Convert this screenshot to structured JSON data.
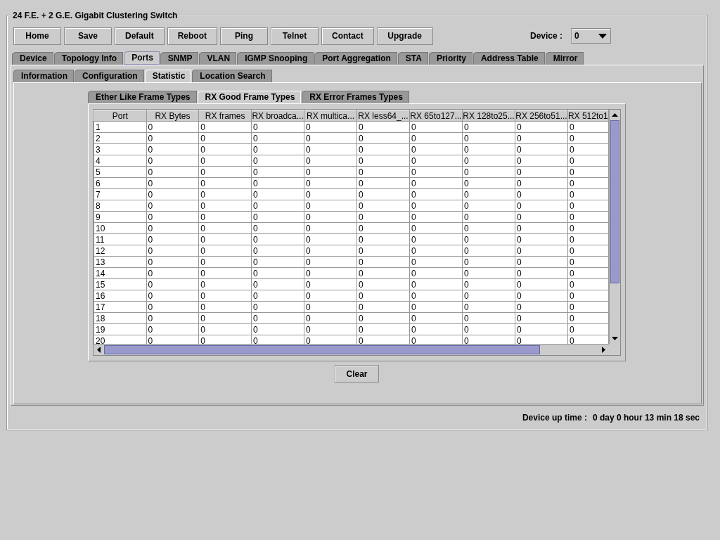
{
  "window": {
    "title": "24 F.E. + 2 G.E. Gigabit Clustering Switch"
  },
  "toolbar": {
    "buttons": [
      "Home",
      "Save",
      "Default",
      "Reboot",
      "Ping",
      "Telnet",
      "Contact",
      "Upgrade"
    ]
  },
  "device_selector": {
    "label": "Device :",
    "value": "0"
  },
  "main_tabs": [
    {
      "label": "Device",
      "selected": false
    },
    {
      "label": "Topology Info",
      "selected": false
    },
    {
      "label": "Ports",
      "selected": true
    },
    {
      "label": "SNMP",
      "selected": false
    },
    {
      "label": "VLAN",
      "selected": false
    },
    {
      "label": "IGMP Snooping",
      "selected": false
    },
    {
      "label": "Port Aggregation",
      "selected": false
    },
    {
      "label": "STA",
      "selected": false
    },
    {
      "label": "Priority",
      "selected": false
    },
    {
      "label": "Address Table",
      "selected": false
    },
    {
      "label": "Mirror",
      "selected": false
    }
  ],
  "sub_tabs": [
    {
      "label": "Information",
      "selected": false
    },
    {
      "label": "Configuration",
      "selected": false
    },
    {
      "label": "Statistic",
      "selected": true
    },
    {
      "label": "Location Search",
      "selected": false
    }
  ],
  "stat_tabs": [
    {
      "label": "Ether Like Frame Types",
      "selected": false
    },
    {
      "label": "RX Good Frame Types",
      "selected": true
    },
    {
      "label": "RX Error Frames Types",
      "selected": false
    }
  ],
  "table": {
    "columns": [
      "Port",
      "RX Bytes",
      "RX frames",
      "RX broadca...",
      "RX multica...",
      "RX less64_...",
      "RX 65to127...",
      "RX 128to25...",
      "RX 256to51...",
      "RX 512to1"
    ],
    "rows": [
      [
        "1",
        "0",
        "0",
        "0",
        "0",
        "0",
        "0",
        "0",
        "0",
        "0"
      ],
      [
        "2",
        "0",
        "0",
        "0",
        "0",
        "0",
        "0",
        "0",
        "0",
        "0"
      ],
      [
        "3",
        "0",
        "0",
        "0",
        "0",
        "0",
        "0",
        "0",
        "0",
        "0"
      ],
      [
        "4",
        "0",
        "0",
        "0",
        "0",
        "0",
        "0",
        "0",
        "0",
        "0"
      ],
      [
        "5",
        "0",
        "0",
        "0",
        "0",
        "0",
        "0",
        "0",
        "0",
        "0"
      ],
      [
        "6",
        "0",
        "0",
        "0",
        "0",
        "0",
        "0",
        "0",
        "0",
        "0"
      ],
      [
        "7",
        "0",
        "0",
        "0",
        "0",
        "0",
        "0",
        "0",
        "0",
        "0"
      ],
      [
        "8",
        "0",
        "0",
        "0",
        "0",
        "0",
        "0",
        "0",
        "0",
        "0"
      ],
      [
        "9",
        "0",
        "0",
        "0",
        "0",
        "0",
        "0",
        "0",
        "0",
        "0"
      ],
      [
        "10",
        "0",
        "0",
        "0",
        "0",
        "0",
        "0",
        "0",
        "0",
        "0"
      ],
      [
        "11",
        "0",
        "0",
        "0",
        "0",
        "0",
        "0",
        "0",
        "0",
        "0"
      ],
      [
        "12",
        "0",
        "0",
        "0",
        "0",
        "0",
        "0",
        "0",
        "0",
        "0"
      ],
      [
        "13",
        "0",
        "0",
        "0",
        "0",
        "0",
        "0",
        "0",
        "0",
        "0"
      ],
      [
        "14",
        "0",
        "0",
        "0",
        "0",
        "0",
        "0",
        "0",
        "0",
        "0"
      ],
      [
        "15",
        "0",
        "0",
        "0",
        "0",
        "0",
        "0",
        "0",
        "0",
        "0"
      ],
      [
        "16",
        "0",
        "0",
        "0",
        "0",
        "0",
        "0",
        "0",
        "0",
        "0"
      ],
      [
        "17",
        "0",
        "0",
        "0",
        "0",
        "0",
        "0",
        "0",
        "0",
        "0"
      ],
      [
        "18",
        "0",
        "0",
        "0",
        "0",
        "0",
        "0",
        "0",
        "0",
        "0"
      ],
      [
        "19",
        "0",
        "0",
        "0",
        "0",
        "0",
        "0",
        "0",
        "0",
        "0"
      ],
      [
        "20",
        "0",
        "0",
        "0",
        "0",
        "0",
        "0",
        "0",
        "0",
        "0"
      ]
    ]
  },
  "clear_button": "Clear",
  "status": {
    "label": "Device up time :",
    "value": "0 day 0 hour 13 min 18 sec"
  }
}
